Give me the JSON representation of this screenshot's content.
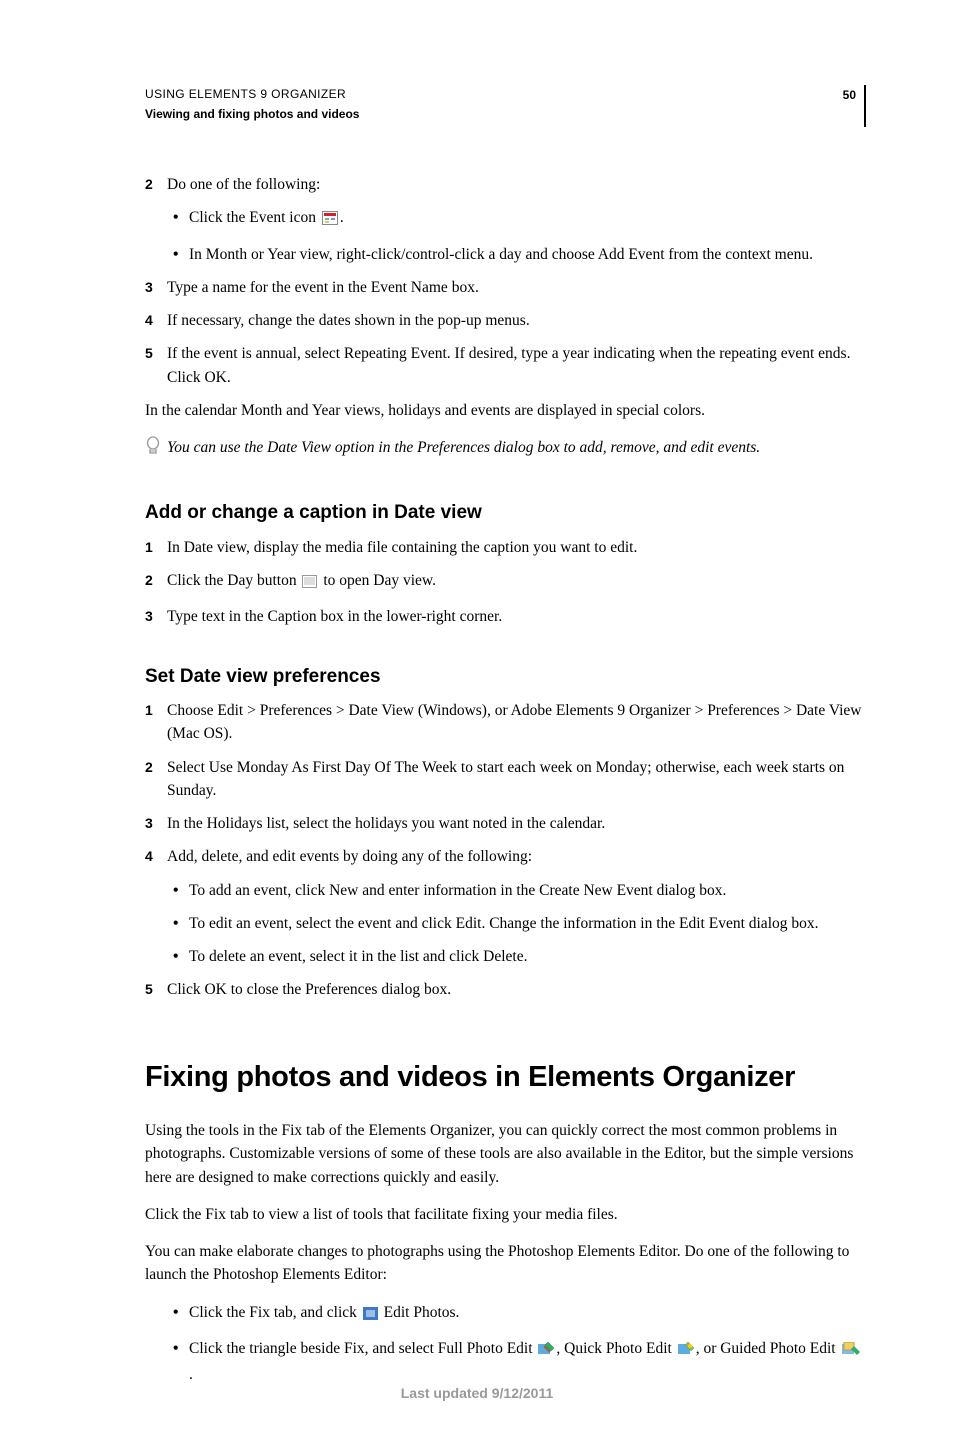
{
  "header": {
    "running": "USING ELEMENTS 9 ORGANIZER",
    "sub": "Viewing and fixing photos and videos",
    "page": "50"
  },
  "body": {
    "step2": {
      "num": "2",
      "text": "Do one of the following:"
    },
    "b1a": "Click the Event icon ",
    "b1a_end": ".",
    "b1b": "In Month or Year view, right-click/control-click a day and choose Add Event from the context menu.",
    "step3": {
      "num": "3",
      "text": "Type a name for the event in the Event Name box."
    },
    "step4": {
      "num": "4",
      "text": "If necessary, change the dates shown in the pop-up menus."
    },
    "step5": {
      "num": "5",
      "text": "If the event is annual, select Repeating Event. If desired, type a year indicating when the repeating event ends. Click OK."
    },
    "p1": "In the calendar Month and Year views, holidays and events are displayed in special colors.",
    "tip": "You can use the Date View option in the Preferences dialog box to add, remove, and edit events.",
    "h2a": "Add or change a caption in Date view",
    "a1": {
      "num": "1",
      "text": "In Date view, display the media file containing the caption you want to edit."
    },
    "a2": {
      "num": "2",
      "pre": "Click the Day button ",
      "post": " to open Day view."
    },
    "a3": {
      "num": "3",
      "text": "Type text in the Caption box in the lower-right corner."
    },
    "h2b": "Set Date view preferences",
    "c1": {
      "num": "1",
      "text": "Choose Edit > Preferences > Date View (Windows), or Adobe Elements 9 Organizer > Preferences > Date View (Mac OS)."
    },
    "c2": {
      "num": "2",
      "text": "Select Use Monday As First Day Of The Week to start each week on Monday; otherwise, each week starts on Sunday."
    },
    "c3": {
      "num": "3",
      "text": "In the Holidays list, select the holidays you want noted in the calendar."
    },
    "c4": {
      "num": "4",
      "text": "Add, delete, and edit events by doing any of the following:"
    },
    "cb1": "To add an event, click New and enter information in the Create New Event dialog box.",
    "cb2": "To edit an event, select the event and click Edit. Change the information in the Edit Event dialog box.",
    "cb3": "To delete an event, select it in the list and click Delete.",
    "c5": {
      "num": "5",
      "text": "Click OK to close the Preferences dialog box."
    },
    "h1": "Fixing photos and videos in Elements Organizer",
    "fp1": "Using the tools in the Fix tab of the Elements Organizer, you can quickly correct the most common problems in photographs. Customizable versions of some of these tools are also available in the Editor, but the simple versions here are designed to make corrections quickly and easily.",
    "fp2": "Click the Fix tab to view a list of tools that facilitate fixing your media files.",
    "fp3": "You can make elaborate changes to photographs using the Photoshop Elements Editor. Do one of the following to launch the Photoshop Elements Editor:",
    "fb1a": "Click the Fix tab, and click ",
    "fb1b": " Edit Photos.",
    "fb2a": "Click the triangle beside Fix, and select Full Photo Edit ",
    "fb2b": ", Quick Photo Edit ",
    "fb2c": ", or Guided Photo Edit ",
    "fb2d": "."
  },
  "footer": "Last updated 9/12/2011"
}
